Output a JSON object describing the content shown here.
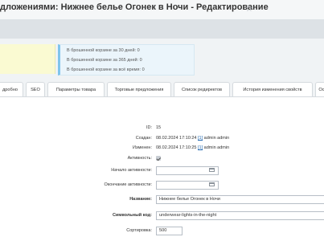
{
  "header": {
    "title": "дложениями: Нижнее белье Огонек в Ночи - Редактирование",
    "star_icon": "star-icon"
  },
  "info": {
    "lines": [
      "В брошенной корзине за 30 дней: 0",
      "В брошенной корзине за 365 дней: 0",
      "В брошенной корзине за всё время: 0"
    ]
  },
  "tabs": [
    {
      "label": "дробно"
    },
    {
      "label": "SEO"
    },
    {
      "label": "Параметры товара"
    },
    {
      "label": "Торговые предложения"
    },
    {
      "label": "Список редиректов"
    },
    {
      "label": "История изменения свойств"
    },
    {
      "label": "Ос"
    }
  ],
  "form": {
    "id_label": "ID:",
    "id_value": "15",
    "created_label": "Создан:",
    "created_date": "08.02.2024 17:10:24",
    "created_user_id": "[1]",
    "created_user_name": "admin admin",
    "changed_label": "Изменен:",
    "changed_date": "08.02.2024 17:10:25",
    "changed_user_id": "[1]",
    "changed_user_name": "admin admin",
    "active_label": "Активность:",
    "active_checked": true,
    "active_from_label": "Начало активности:",
    "active_from_value": "",
    "active_to_label": "Окончание активности:",
    "active_to_value": "",
    "name_label": "Название:",
    "name_value": "Нижнее белье Огонек в Ночи",
    "code_label": "Символьный код:",
    "code_value": "underwear-lights-in-the-night",
    "sort_label": "Сортировка:",
    "sort_value": "500"
  }
}
